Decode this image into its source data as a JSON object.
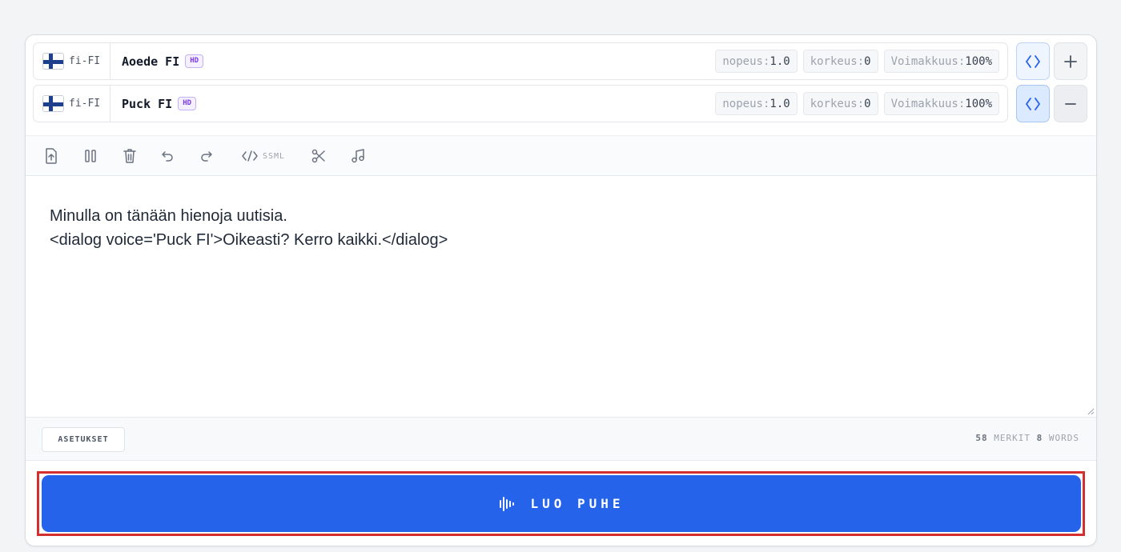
{
  "voices": [
    {
      "flag": "finland-flag",
      "lang": "fi-FI",
      "name": "Aoede FI",
      "badge": "HD",
      "params": [
        {
          "label": "nopeus:",
          "value": "1.0"
        },
        {
          "label": "korkeus:",
          "value": "0"
        },
        {
          "label": "Voimakkuus:",
          "value": "100%"
        }
      ],
      "action_icon": "plus-icon"
    },
    {
      "flag": "finland-flag",
      "lang": "fi-FI",
      "name": "Puck FI",
      "badge": "HD",
      "params": [
        {
          "label": "nopeus:",
          "value": "1.0"
        },
        {
          "label": "korkeus:",
          "value": "0"
        },
        {
          "label": "Voimakkuus:",
          "value": "100%"
        }
      ],
      "action_icon": "minus-icon"
    }
  ],
  "toolbar": {
    "tools": [
      "upload-icon",
      "pause-icon",
      "trash-icon",
      "undo-icon",
      "redo-icon",
      "ssml-code-icon",
      "scissors-icon",
      "music-note-icon"
    ],
    "ssml_label": "SSML"
  },
  "editor": {
    "text": "Minulla on tänään hienoja uutisia.\n<dialog voice='Puck FI'>Oikeasti? Kerro kaikki.</dialog>"
  },
  "footer": {
    "settings_label": "ASETUKSET",
    "char_count": "58",
    "char_label": "MERKIT",
    "word_count": "8",
    "word_label": "WORDS"
  },
  "generate": {
    "label": "LUO PUHE",
    "icon": "audio-waveform-icon"
  },
  "colors": {
    "accent": "#2563eb",
    "highlight": "#d32f2f",
    "badge": "#7c3aed"
  }
}
